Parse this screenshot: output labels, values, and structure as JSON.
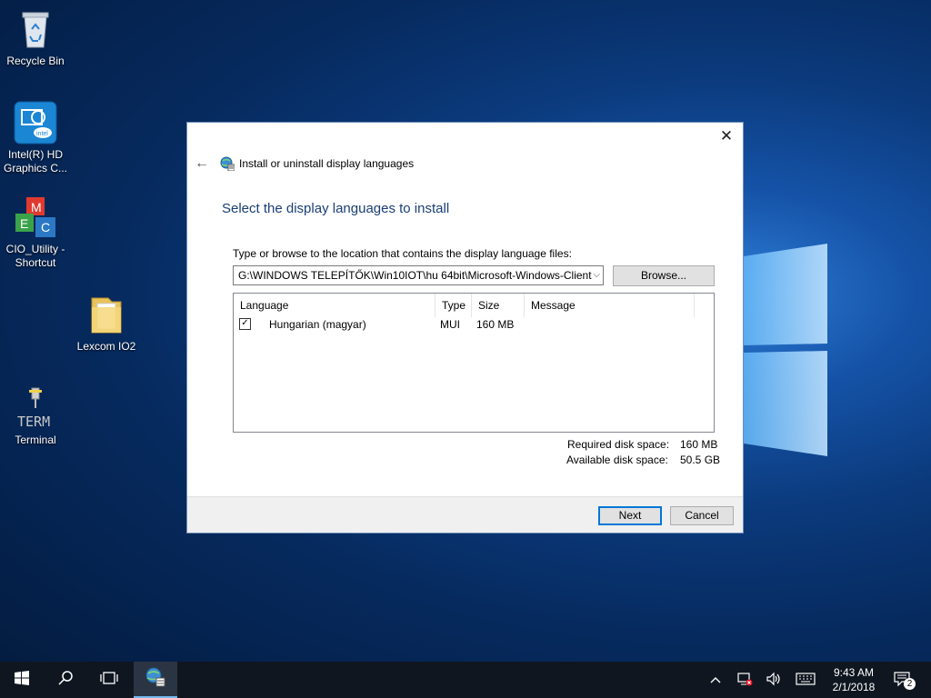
{
  "desktop": {
    "icons": [
      {
        "label": "Recycle Bin"
      },
      {
        "label": "Intel(R) HD Graphics C..."
      },
      {
        "label": "CIO_Utility - Shortcut"
      },
      {
        "label": "Lexcom IO2"
      },
      {
        "label": "Terminal"
      }
    ]
  },
  "dialog": {
    "title": "Install or uninstall display languages",
    "heading": "Select the display languages to install",
    "prompt": "Type or browse to the location that contains the display language files:",
    "path_value": "G:\\WINDOWS TELEPÍTŐK\\Win10IOT\\hu 64bit\\Microsoft-Windows-Client",
    "browse_label": "Browse...",
    "table": {
      "columns": [
        "Language",
        "Type",
        "Size",
        "Message"
      ],
      "rows": [
        {
          "checked": true,
          "language": "Hungarian (magyar)",
          "type": "MUI",
          "size": "160 MB",
          "message": ""
        }
      ]
    },
    "required_label": "Required disk space:",
    "required_value": "160 MB",
    "available_label": "Available disk space:",
    "available_value": "50.5 GB",
    "next_label": "Next",
    "cancel_label": "Cancel"
  },
  "taskbar": {
    "time": "9:43 AM",
    "date": "2/1/2018",
    "notification_count": "2"
  },
  "colors": {
    "accent": "#0078d7",
    "heading": "#1a3e74",
    "taskbar": "#0f1620"
  }
}
